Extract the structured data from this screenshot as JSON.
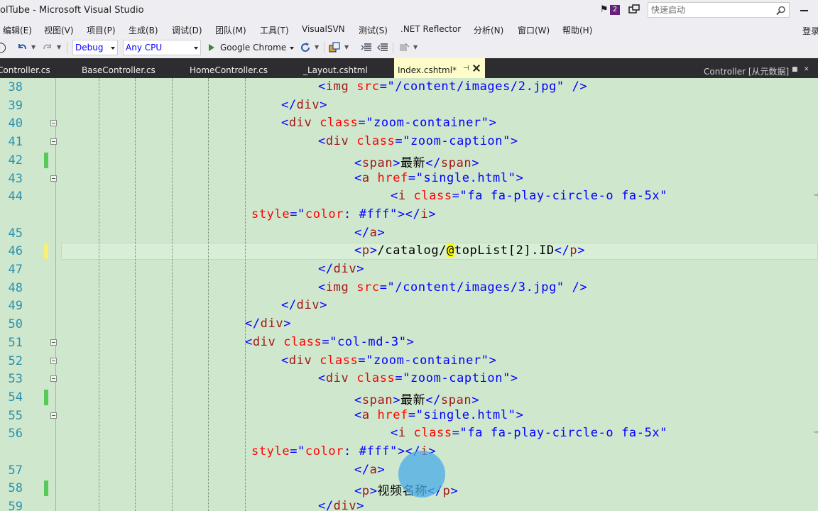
{
  "window": {
    "title": "olTube - Microsoft Visual Studio",
    "notification_count": "2",
    "quick_launch_placeholder": "快速启动"
  },
  "menu": {
    "items": [
      "编辑(E)",
      "视图(V)",
      "项目(P)",
      "生成(B)",
      "调试(D)",
      "团队(M)",
      "工具(T)",
      "VisualSVN",
      "测试(S)",
      ".NET Reflector",
      "分析(N)",
      "窗口(W)",
      "帮助(H)"
    ],
    "login": "登录"
  },
  "toolbar": {
    "config": "Debug",
    "platform": "Any CPU",
    "browser": "Google Chrome"
  },
  "tabs": {
    "items": [
      "Controller.cs",
      "BaseController.cs",
      "HomeController.cs",
      "_Layout.cshtml",
      "Index.cshtml*"
    ],
    "right_label": "Controller [从元数据]"
  },
  "editor": {
    "lines": [
      {
        "n": "38",
        "parts": [
          [
            "br",
            "<"
          ],
          [
            "tag",
            "img"
          ],
          [
            "txt",
            " "
          ],
          [
            "attr",
            "src"
          ],
          [
            "br",
            "=\"/content/images/2.jpg\" />"
          ]
        ]
      },
      {
        "n": "39",
        "parts": [
          [
            "br",
            "</"
          ],
          [
            "tag",
            "div"
          ],
          [
            "br",
            ">"
          ]
        ]
      },
      {
        "n": "40",
        "parts": [
          [
            "br",
            "<"
          ],
          [
            "tag",
            "div"
          ],
          [
            "txt",
            " "
          ],
          [
            "attr",
            "class"
          ],
          [
            "br",
            "=\"zoom-container\">"
          ]
        ]
      },
      {
        "n": "41",
        "parts": [
          [
            "br",
            "<"
          ],
          [
            "tag",
            "div"
          ],
          [
            "txt",
            " "
          ],
          [
            "attr",
            "class"
          ],
          [
            "br",
            "=\"zoom-caption\">"
          ]
        ]
      },
      {
        "n": "42",
        "parts": [
          [
            "br",
            "<"
          ],
          [
            "tag",
            "span"
          ],
          [
            "br",
            ">"
          ],
          [
            "txt",
            "最新"
          ],
          [
            "br",
            "</"
          ],
          [
            "tag",
            "span"
          ],
          [
            "br",
            ">"
          ]
        ]
      },
      {
        "n": "43",
        "parts": [
          [
            "br",
            "<"
          ],
          [
            "tag",
            "a"
          ],
          [
            "txt",
            " "
          ],
          [
            "attr",
            "href"
          ],
          [
            "br",
            "=\"single.html\">"
          ]
        ]
      },
      {
        "n": "44",
        "parts": [
          [
            "br",
            "<"
          ],
          [
            "tag",
            "i"
          ],
          [
            "txt",
            " "
          ],
          [
            "attr",
            "class"
          ],
          [
            "br",
            "=\"fa fa-play-circle-o fa-5x\""
          ]
        ]
      },
      {
        "n": "",
        "parts": [
          [
            "attr",
            "style"
          ],
          [
            "br",
            "=\""
          ],
          [
            "attr",
            "color"
          ],
          [
            "br",
            ": #fff\"></"
          ],
          [
            "tag",
            "i"
          ],
          [
            "br",
            ">"
          ]
        ]
      },
      {
        "n": "45",
        "parts": [
          [
            "br",
            "</"
          ],
          [
            "tag",
            "a"
          ],
          [
            "br",
            ">"
          ]
        ]
      },
      {
        "n": "46",
        "parts": [
          [
            "br",
            "<"
          ],
          [
            "tag",
            "p"
          ],
          [
            "br",
            ">"
          ],
          [
            "txt",
            "/catalog/"
          ],
          [
            "razor",
            "@"
          ],
          [
            "txt",
            "topList[2].ID"
          ],
          [
            "br",
            "</"
          ],
          [
            "tag",
            "p"
          ],
          [
            "br",
            ">"
          ]
        ]
      },
      {
        "n": "47",
        "parts": [
          [
            "br",
            "</"
          ],
          [
            "tag",
            "div"
          ],
          [
            "br",
            ">"
          ]
        ]
      },
      {
        "n": "48",
        "parts": [
          [
            "br",
            "<"
          ],
          [
            "tag",
            "img"
          ],
          [
            "txt",
            " "
          ],
          [
            "attr",
            "src"
          ],
          [
            "br",
            "=\"/content/images/3.jpg\" />"
          ]
        ]
      },
      {
        "n": "49",
        "parts": [
          [
            "br",
            "</"
          ],
          [
            "tag",
            "div"
          ],
          [
            "br",
            ">"
          ]
        ]
      },
      {
        "n": "50",
        "parts": [
          [
            "br",
            "</"
          ],
          [
            "tag",
            "div"
          ],
          [
            "br",
            ">"
          ]
        ]
      },
      {
        "n": "51",
        "parts": [
          [
            "br",
            "<"
          ],
          [
            "tag",
            "div"
          ],
          [
            "txt",
            " "
          ],
          [
            "attr",
            "class"
          ],
          [
            "br",
            "=\"col-md-3\">"
          ]
        ]
      },
      {
        "n": "52",
        "parts": [
          [
            "br",
            "<"
          ],
          [
            "tag",
            "div"
          ],
          [
            "txt",
            " "
          ],
          [
            "attr",
            "class"
          ],
          [
            "br",
            "=\"zoom-container\">"
          ]
        ]
      },
      {
        "n": "53",
        "parts": [
          [
            "br",
            "<"
          ],
          [
            "tag",
            "div"
          ],
          [
            "txt",
            " "
          ],
          [
            "attr",
            "class"
          ],
          [
            "br",
            "=\"zoom-caption\">"
          ]
        ]
      },
      {
        "n": "54",
        "parts": [
          [
            "br",
            "<"
          ],
          [
            "tag",
            "span"
          ],
          [
            "br",
            ">"
          ],
          [
            "txt",
            "最新"
          ],
          [
            "br",
            "</"
          ],
          [
            "tag",
            "span"
          ],
          [
            "br",
            ">"
          ]
        ]
      },
      {
        "n": "55",
        "parts": [
          [
            "br",
            "<"
          ],
          [
            "tag",
            "a"
          ],
          [
            "txt",
            " "
          ],
          [
            "attr",
            "href"
          ],
          [
            "br",
            "=\"single.html\">"
          ]
        ]
      },
      {
        "n": "56",
        "parts": [
          [
            "br",
            "<"
          ],
          [
            "tag",
            "i"
          ],
          [
            "txt",
            " "
          ],
          [
            "attr",
            "class"
          ],
          [
            "br",
            "=\"fa fa-play-circle-o fa-5x\""
          ]
        ]
      },
      {
        "n": "",
        "parts": [
          [
            "attr",
            "style"
          ],
          [
            "br",
            "=\""
          ],
          [
            "attr",
            "color"
          ],
          [
            "br",
            ": #fff\"></"
          ],
          [
            "tag",
            "i"
          ],
          [
            "br",
            ">"
          ]
        ]
      },
      {
        "n": "57",
        "parts": [
          [
            "br",
            "</"
          ],
          [
            "tag",
            "a"
          ],
          [
            "br",
            ">"
          ]
        ]
      },
      {
        "n": "58",
        "parts": [
          [
            "br",
            "<"
          ],
          [
            "tag",
            "p"
          ],
          [
            "br",
            ">"
          ],
          [
            "txt",
            "视频名称"
          ],
          [
            "br",
            "</"
          ],
          [
            "tag",
            "p"
          ],
          [
            "br",
            ">"
          ]
        ]
      },
      {
        "n": "59",
        "parts": [
          [
            "br",
            "</"
          ],
          [
            "tag",
            "div"
          ],
          [
            "br",
            ">"
          ]
        ]
      }
    ]
  }
}
